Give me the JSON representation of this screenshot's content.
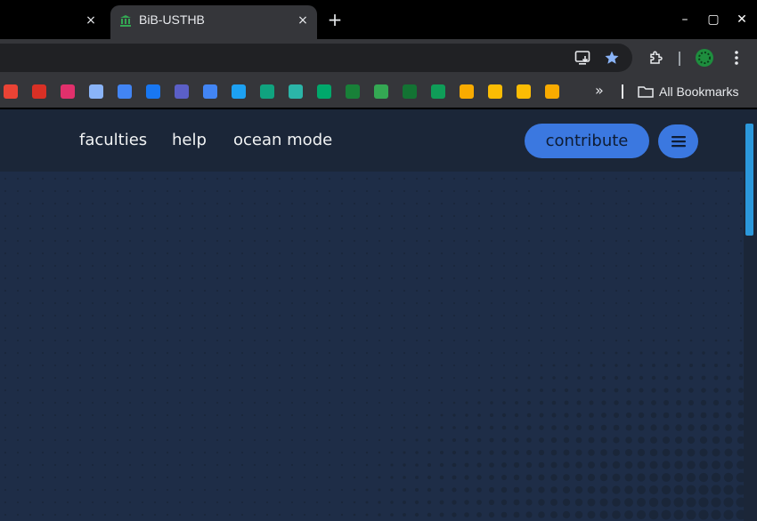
{
  "tabs": {
    "active_title": "BiB-USTHB"
  },
  "window": {
    "new_tab": "+",
    "minimize": "–",
    "maximize": "▢",
    "close": "✕",
    "tab_close": "×"
  },
  "bookmarks_bar": {
    "more": "»",
    "all_bookmarks_label": "All Bookmarks",
    "items": [
      {
        "icon": "pinwheel-icon",
        "color": "#ea4335"
      },
      {
        "icon": "gmail-icon",
        "color": "#d93025"
      },
      {
        "icon": "instagram-icon",
        "color": "#e1306c"
      },
      {
        "icon": "gemini-icon",
        "color": "#8ab4f8"
      },
      {
        "icon": "refresh-arrow-icon",
        "color": "#4285f4"
      },
      {
        "icon": "facebook-icon",
        "color": "#1877f2"
      },
      {
        "icon": "teams-icon",
        "color": "#5b5fc7"
      },
      {
        "icon": "translate-icon",
        "color": "#4285f4"
      },
      {
        "icon": "s-logo-icon",
        "color": "#1da1f2"
      },
      {
        "icon": "chatgpt-icon",
        "color": "#10a37f"
      },
      {
        "icon": "p-logo-icon",
        "color": "#2bb5a8"
      },
      {
        "icon": "fi-logo-icon",
        "color": "#00a86b"
      },
      {
        "icon": "sheets-plus-icon",
        "color": "#188038"
      },
      {
        "icon": "museum-icon",
        "color": "#34a853"
      },
      {
        "icon": "wave-icon",
        "color": "#137333"
      },
      {
        "icon": "sqrt-icon",
        "color": "#0f9d58"
      },
      {
        "icon": "classroom-icon",
        "color": "#f9ab00"
      },
      {
        "icon": "pencil-icon",
        "color": "#fbbc04"
      },
      {
        "icon": "keep-icon",
        "color": "#fbbc04"
      },
      {
        "icon": "analytics-icon",
        "color": "#f9ab00"
      }
    ]
  },
  "site_nav": {
    "links": [
      "faculties",
      "help",
      "ocean mode"
    ],
    "contribute_label": "contribute"
  },
  "colors": {
    "accent": "#3b78e0",
    "page_bg": "#1d2b44",
    "nav_bg": "#1b2638",
    "scroll_thumb": "#2b98dc"
  }
}
